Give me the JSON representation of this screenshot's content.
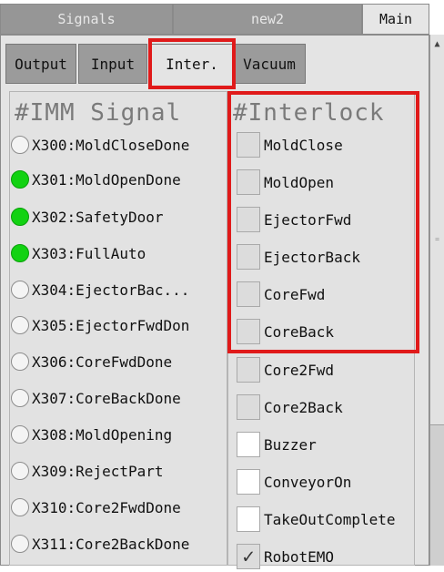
{
  "top_tabs": [
    {
      "label": "Signals",
      "active": false
    },
    {
      "label": "new2",
      "active": false
    },
    {
      "label": "Main",
      "active": true
    }
  ],
  "sub_tabs": [
    {
      "label": "Output",
      "active": false
    },
    {
      "label": "Input",
      "active": false
    },
    {
      "label": "Inter.",
      "active": true
    },
    {
      "label": "Vacuum",
      "active": false
    }
  ],
  "imm": {
    "title": "#IMM Signal",
    "signals": [
      {
        "label": "X300:MoldCloseDone",
        "on": false
      },
      {
        "label": "X301:MoldOpenDone",
        "on": true
      },
      {
        "label": "X302:SafetyDoor",
        "on": true
      },
      {
        "label": "X303:FullAuto",
        "on": true
      },
      {
        "label": "X304:EjectorBac...",
        "on": false
      },
      {
        "label": "X305:EjectorFwdDon",
        "on": false
      },
      {
        "label": "X306:CoreFwdDone",
        "on": false
      },
      {
        "label": "X307:CoreBackDone",
        "on": false
      },
      {
        "label": "X308:MoldOpening",
        "on": false
      },
      {
        "label": "X309:RejectPart",
        "on": false
      },
      {
        "label": "X310:Core2FwdDone",
        "on": false
      },
      {
        "label": "X311:Core2BackDone",
        "on": false
      }
    ]
  },
  "interlock": {
    "title": "#Interlock",
    "items": [
      {
        "label": "MoldClose",
        "style": "gray",
        "checked": false
      },
      {
        "label": "MoldOpen",
        "style": "gray",
        "checked": false
      },
      {
        "label": "EjectorFwd",
        "style": "gray",
        "checked": false
      },
      {
        "label": "EjectorBack",
        "style": "gray",
        "checked": false
      },
      {
        "label": "CoreFwd",
        "style": "gray",
        "checked": false
      },
      {
        "label": "CoreBack",
        "style": "gray",
        "checked": false
      },
      {
        "label": "Core2Fwd",
        "style": "gray",
        "checked": false
      },
      {
        "label": "Core2Back",
        "style": "gray",
        "checked": false
      },
      {
        "label": "Buzzer",
        "style": "white",
        "checked": false
      },
      {
        "label": "ConveyorOn",
        "style": "white",
        "checked": false
      },
      {
        "label": "TakeOutComplete",
        "style": "white",
        "checked": false
      },
      {
        "label": "RobotEMO",
        "style": "gray",
        "checked": true
      }
    ]
  },
  "colors": {
    "highlight": "#e01a1a",
    "led_on": "#12d212",
    "tab_inactive": "#969696"
  }
}
